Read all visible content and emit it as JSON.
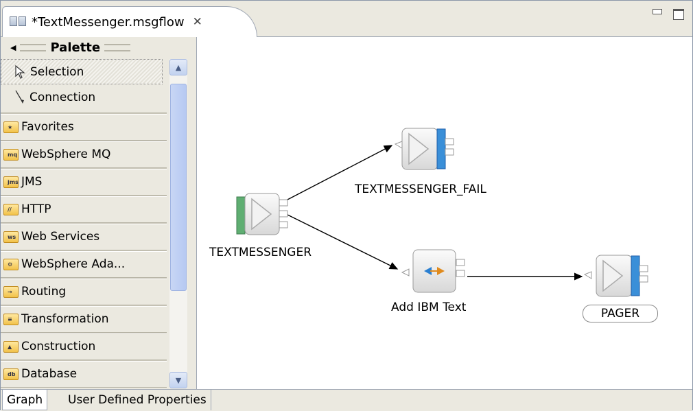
{
  "editor": {
    "tab_title": "*TextMessenger.msgflow",
    "close_glyph": "✕"
  },
  "palette": {
    "title": "Palette",
    "tools": [
      {
        "label": "Selection",
        "icon": "arrow-cursor-icon"
      },
      {
        "label": "Connection",
        "icon": "connection-line-icon"
      }
    ],
    "drawers": [
      {
        "label": "Favorites",
        "icon": "favorites-folder-icon",
        "badge": "★"
      },
      {
        "label": "WebSphere MQ",
        "icon": "mq-folder-icon",
        "badge": "mq"
      },
      {
        "label": "JMS",
        "icon": "jms-folder-icon",
        "badge": "jms"
      },
      {
        "label": "HTTP",
        "icon": "http-folder-icon",
        "badge": "//"
      },
      {
        "label": "Web Services",
        "icon": "web-services-folder-icon",
        "badge": "ws"
      },
      {
        "label": "WebSphere Ada...",
        "icon": "adapters-folder-icon",
        "badge": "⚙"
      },
      {
        "label": "Routing",
        "icon": "routing-folder-icon",
        "badge": "→"
      },
      {
        "label": "Transformation",
        "icon": "transformation-folder-icon",
        "badge": "≡"
      },
      {
        "label": "Construction",
        "icon": "construction-folder-icon",
        "badge": "▲"
      },
      {
        "label": "Database",
        "icon": "database-folder-icon",
        "badge": "db"
      }
    ]
  },
  "canvas": {
    "nodes": {
      "input": {
        "label": "TEXTMESSENGER"
      },
      "fail": {
        "label": "TEXTMESSENGER_FAIL"
      },
      "compute": {
        "label": "Add IBM Text"
      },
      "pager": {
        "label": "PAGER"
      }
    }
  },
  "bottom_tabs": [
    {
      "label": "Graph",
      "active": true
    },
    {
      "label": "User Defined Properties",
      "active": false
    }
  ],
  "colors": {
    "input_bar": "#5fae72",
    "output_bar": "#3a8fd8",
    "compute_arrow_left": "#2a7fd1",
    "compute_arrow_right": "#e08a1c"
  }
}
